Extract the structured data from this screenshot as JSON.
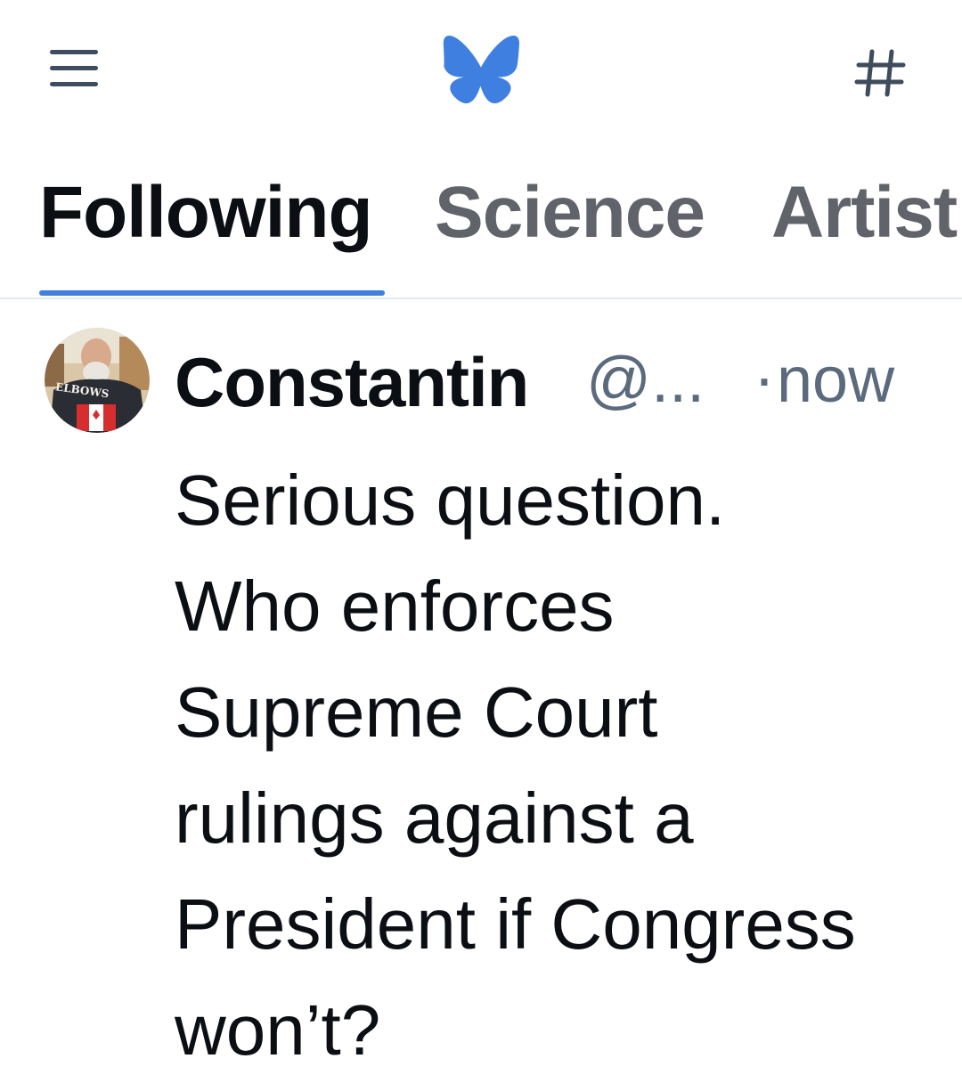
{
  "header": {
    "menu_icon": "hamburger-menu-icon",
    "logo_icon": "butterfly-logo-icon",
    "feeds_icon": "hashtag-icon",
    "feeds_symbol": "#",
    "logo_color": "#3f7fe0"
  },
  "tabs": [
    {
      "label": "Following",
      "active": true
    },
    {
      "label": "Science",
      "active": false
    },
    {
      "label": "Artist",
      "active": false
    }
  ],
  "colors": {
    "accent": "#3f7fe0",
    "muted": "#5b6a7c",
    "text": "#0b0f14"
  },
  "post": {
    "author": "Constantin",
    "handle": "@...",
    "separator": "·",
    "time": "now",
    "avatar_text": "ELBOWS",
    "lines": [
      "Serious question.",
      "Who enforces",
      "Supreme Court",
      "rulings against a",
      "President if Congress",
      "won’t?"
    ]
  }
}
